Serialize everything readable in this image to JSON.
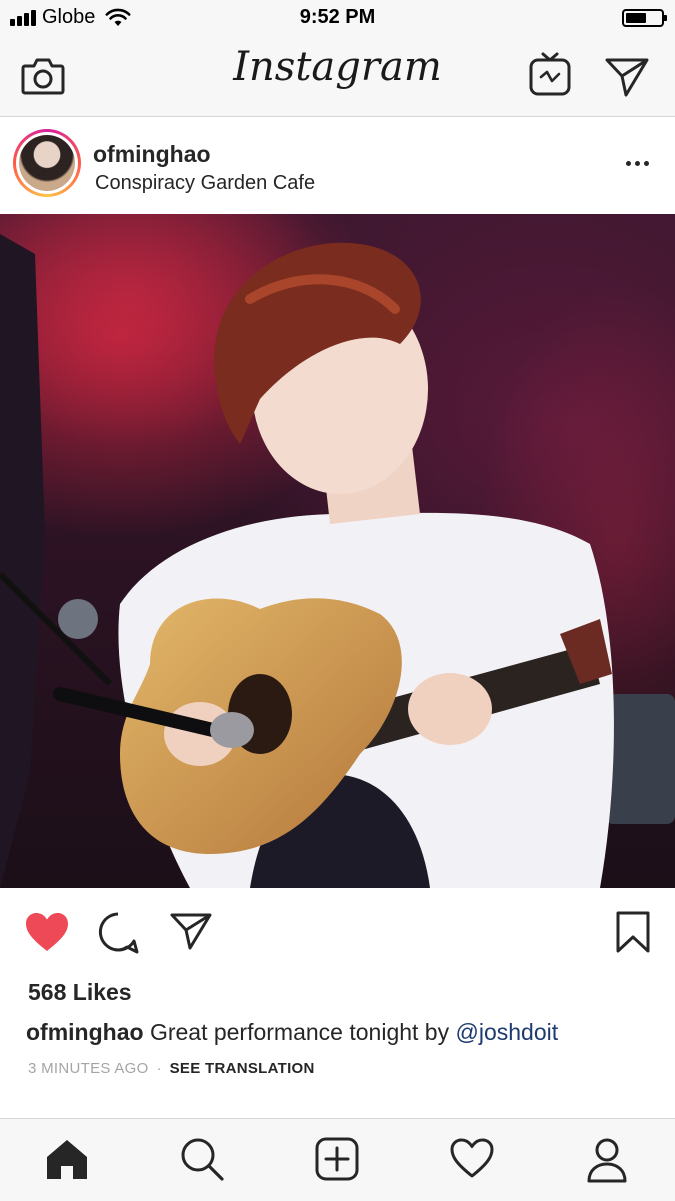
{
  "status_bar": {
    "carrier": "Globe",
    "time": "9:52 PM",
    "battery_level": 0.6
  },
  "header": {
    "logo": "Instagram",
    "icons": [
      "camera-icon",
      "igtv-icon",
      "direct-message-icon"
    ]
  },
  "post": {
    "username": "ofminghao",
    "location": "Conspiracy Garden Cafe",
    "photo_description_icon": "post-photo",
    "liked": true,
    "likes": "568 Likes",
    "caption": {
      "username": "ofminghao",
      "text": "Great performance tonight by",
      "mention": "@joshdoit"
    },
    "time_ago": "3 MINUTES AGO",
    "separator": "·",
    "see_translation": "SEE TRANSLATION"
  },
  "colors": {
    "heart": "#ed4956",
    "mention": "#1e3a6e",
    "muted": "#a5a5a5"
  },
  "tab_bar": {
    "items": [
      "home-icon",
      "search-icon",
      "new-post-icon",
      "activity-icon",
      "profile-icon"
    ]
  }
}
